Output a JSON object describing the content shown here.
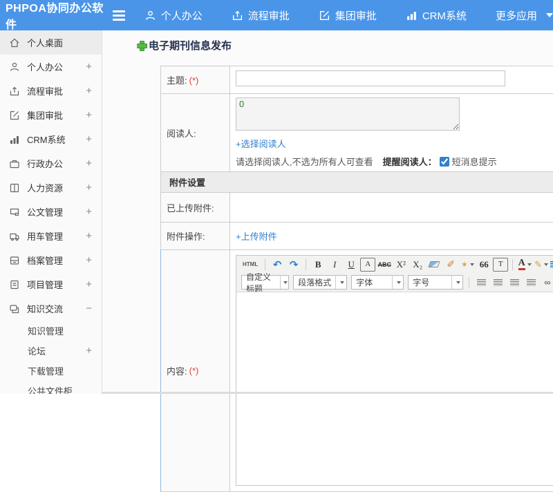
{
  "header": {
    "logo": "PHPOA协同办公软件",
    "nav": [
      {
        "label": "个人办公",
        "icon": "user-icon"
      },
      {
        "label": "流程审批",
        "icon": "share-icon"
      },
      {
        "label": "集团审批",
        "icon": "edit-icon"
      },
      {
        "label": "CRM系统",
        "icon": "chart-icon"
      },
      {
        "label": "更多应用",
        "icon": "caret-down-icon"
      }
    ],
    "accent_color": "#4a95e8"
  },
  "sidebar": {
    "items": [
      {
        "label": "个人桌面",
        "icon": "home-icon",
        "expander": "",
        "active": true
      },
      {
        "label": "个人办公",
        "icon": "user-icon",
        "expander": "+"
      },
      {
        "label": "流程审批",
        "icon": "share-icon",
        "expander": "+"
      },
      {
        "label": "集团审批",
        "icon": "edit-icon",
        "expander": "+"
      },
      {
        "label": "CRM系统",
        "icon": "chart-icon",
        "expander": "+"
      },
      {
        "label": "行政办公",
        "icon": "briefcase-icon",
        "expander": "+"
      },
      {
        "label": "人力资源",
        "icon": "book-icon",
        "expander": "+"
      },
      {
        "label": "公文管理",
        "icon": "document-icon",
        "expander": "+"
      },
      {
        "label": "用车管理",
        "icon": "truck-icon",
        "expander": "+"
      },
      {
        "label": "档案管理",
        "icon": "archive-icon",
        "expander": "+"
      },
      {
        "label": "项目管理",
        "icon": "project-icon",
        "expander": "+"
      },
      {
        "label": "知识交流",
        "icon": "chat-icon",
        "expander": "−"
      }
    ],
    "subitems": [
      {
        "label": "知识管理",
        "expander": ""
      },
      {
        "label": "论坛",
        "expander": "+"
      },
      {
        "label": "下载管理",
        "expander": ""
      },
      {
        "label": "公共文件柜",
        "expander": ""
      }
    ]
  },
  "page": {
    "title": "电子期刊信息发布"
  },
  "form": {
    "subject_label": "主题:",
    "required_mark": "(*)",
    "readers_label": "阅读人:",
    "readers_value": "0",
    "select_readers_link": "+选择阅读人",
    "readers_hint": "请选择阅读人,不选为所有人可查看",
    "remind_label": "提醒阅读人：",
    "sms_checked": "checked",
    "sms_label": "短消息提示",
    "attach_section_title": "附件设置",
    "uploaded_label": "已上传附件:",
    "uploaded_value": "",
    "attach_op_label": "附件操作:",
    "upload_link": "+上传附件",
    "content_label": "内容:"
  },
  "editor": {
    "toolbar_row1": {
      "source": "HTML",
      "undo": "↶",
      "redo": "↷",
      "bold": "B",
      "italic": "I",
      "underline": "U",
      "font_box": "A",
      "strike": "ABC",
      "superscript": "X²",
      "subscript": "X₂",
      "format_brush": "✐",
      "magic_wand": "✶",
      "blockquote": "66",
      "template_box": "T",
      "forecolor": "A",
      "hilitecolor": "✎"
    },
    "toolbar_row2": {
      "heading_select": "自定义标题",
      "paragraph_select": "段落格式",
      "font_select": "字体",
      "size_select": "字号"
    }
  },
  "colors": {
    "header_blue": "#4a95e8",
    "link_blue": "#2f80d0",
    "required_red": "#e23b3b",
    "plus_green": "#5cb849",
    "readers_text_green": "#2f7d32",
    "title_navy": "#25304d"
  }
}
